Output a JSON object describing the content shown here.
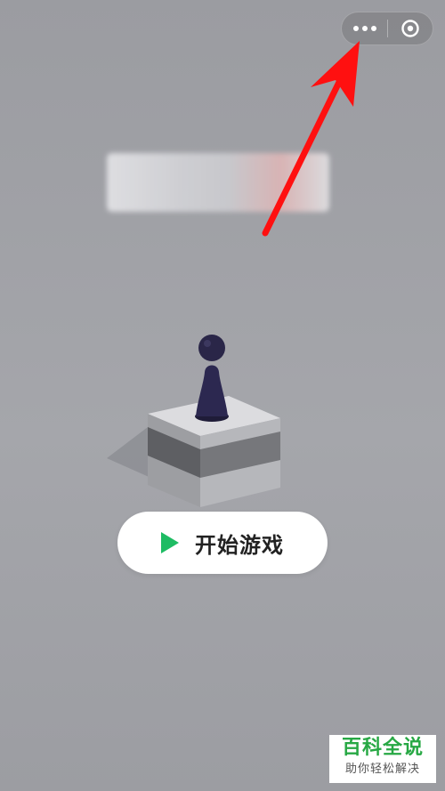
{
  "capsule": {
    "more_icon": "ellipsis-icon",
    "close_icon": "target-circle-icon"
  },
  "title": {
    "text": ""
  },
  "start_button": {
    "icon": "play-icon",
    "label": "开始游戏",
    "icon_color": "#1ebc63"
  },
  "annotation": {
    "arrow_color": "#ff0000"
  },
  "watermark": {
    "title": "百科全说",
    "subtitle": "助你轻松解决"
  }
}
